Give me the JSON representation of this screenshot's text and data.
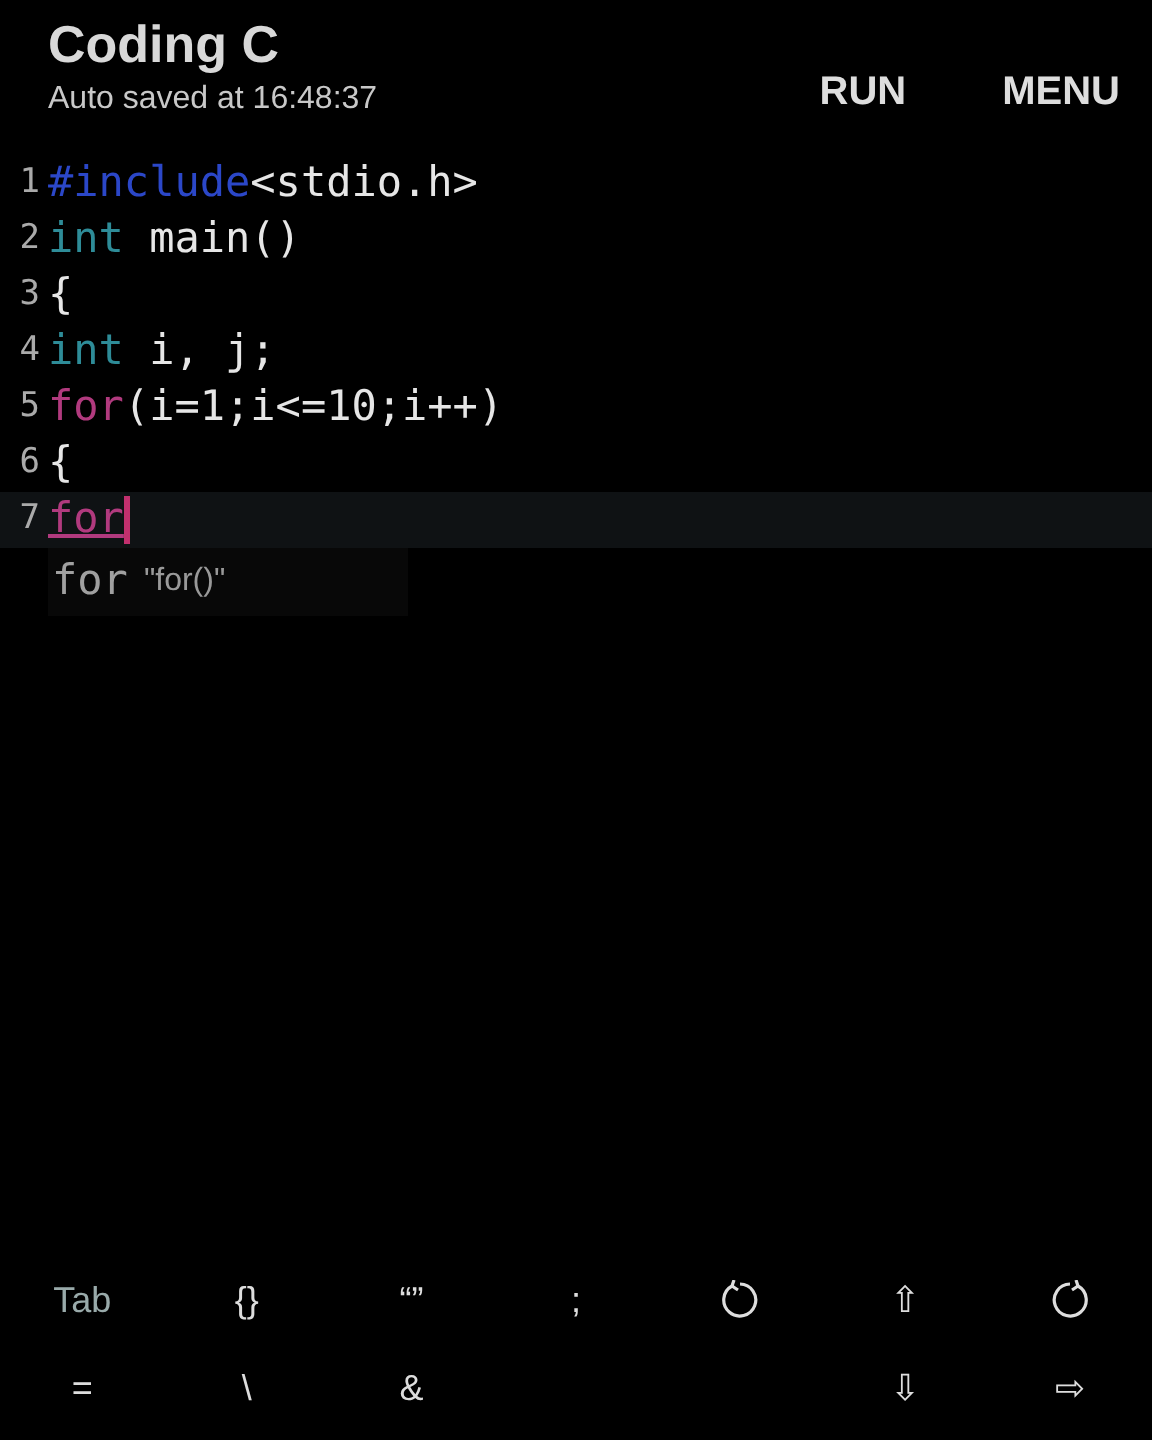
{
  "app_bar": {
    "title": "Coding C",
    "subtitle": "Auto saved at 16:48:37",
    "actions": [
      "RUN",
      "MENU"
    ]
  },
  "editor": {
    "lines": [
      {
        "number": "1",
        "current": false,
        "tokens": [
          {
            "kind": "preproc",
            "text": "#include"
          },
          {
            "kind": "plain",
            "text": "<stdio.h>"
          }
        ]
      },
      {
        "number": "2",
        "current": false,
        "tokens": [
          {
            "kind": "type",
            "text": "int"
          },
          {
            "kind": "plain",
            "text": " main()"
          }
        ]
      },
      {
        "number": "3",
        "current": false,
        "tokens": [
          {
            "kind": "plain",
            "text": "{"
          }
        ]
      },
      {
        "number": "4",
        "current": false,
        "tokens": [
          {
            "kind": "type",
            "text": "int"
          },
          {
            "kind": "plain",
            "text": " i, j;"
          }
        ]
      },
      {
        "number": "5",
        "current": false,
        "tokens": [
          {
            "kind": "keyword",
            "text": "for"
          },
          {
            "kind": "plain",
            "text": "(i=1;i<=10;i++)"
          }
        ]
      },
      {
        "number": "6",
        "current": false,
        "tokens": [
          {
            "kind": "plain",
            "text": "{"
          }
        ]
      },
      {
        "number": "7",
        "current": true,
        "tokens": [
          {
            "kind": "keyword",
            "text": "for",
            "underlined": true
          }
        ]
      }
    ],
    "suggestion": {
      "keyword": "for",
      "hint": "\"for()\""
    }
  },
  "keys": [
    [
      {
        "kind": "text",
        "label": "Tab"
      },
      {
        "kind": "text",
        "label": "{}"
      },
      {
        "kind": "text",
        "label": "“”"
      },
      {
        "kind": "text",
        "label": ";"
      },
      {
        "kind": "undo"
      },
      {
        "kind": "text",
        "label": "⇧"
      },
      {
        "kind": "redo"
      }
    ],
    [
      {
        "kind": "text",
        "label": "="
      },
      {
        "kind": "text",
        "label": "\\"
      },
      {
        "kind": "text",
        "label": "&"
      },
      {
        "kind": "covered"
      },
      {
        "kind": "covered"
      },
      {
        "kind": "text",
        "label": "⇩"
      },
      {
        "kind": "text",
        "label": "⇨"
      }
    ]
  ]
}
